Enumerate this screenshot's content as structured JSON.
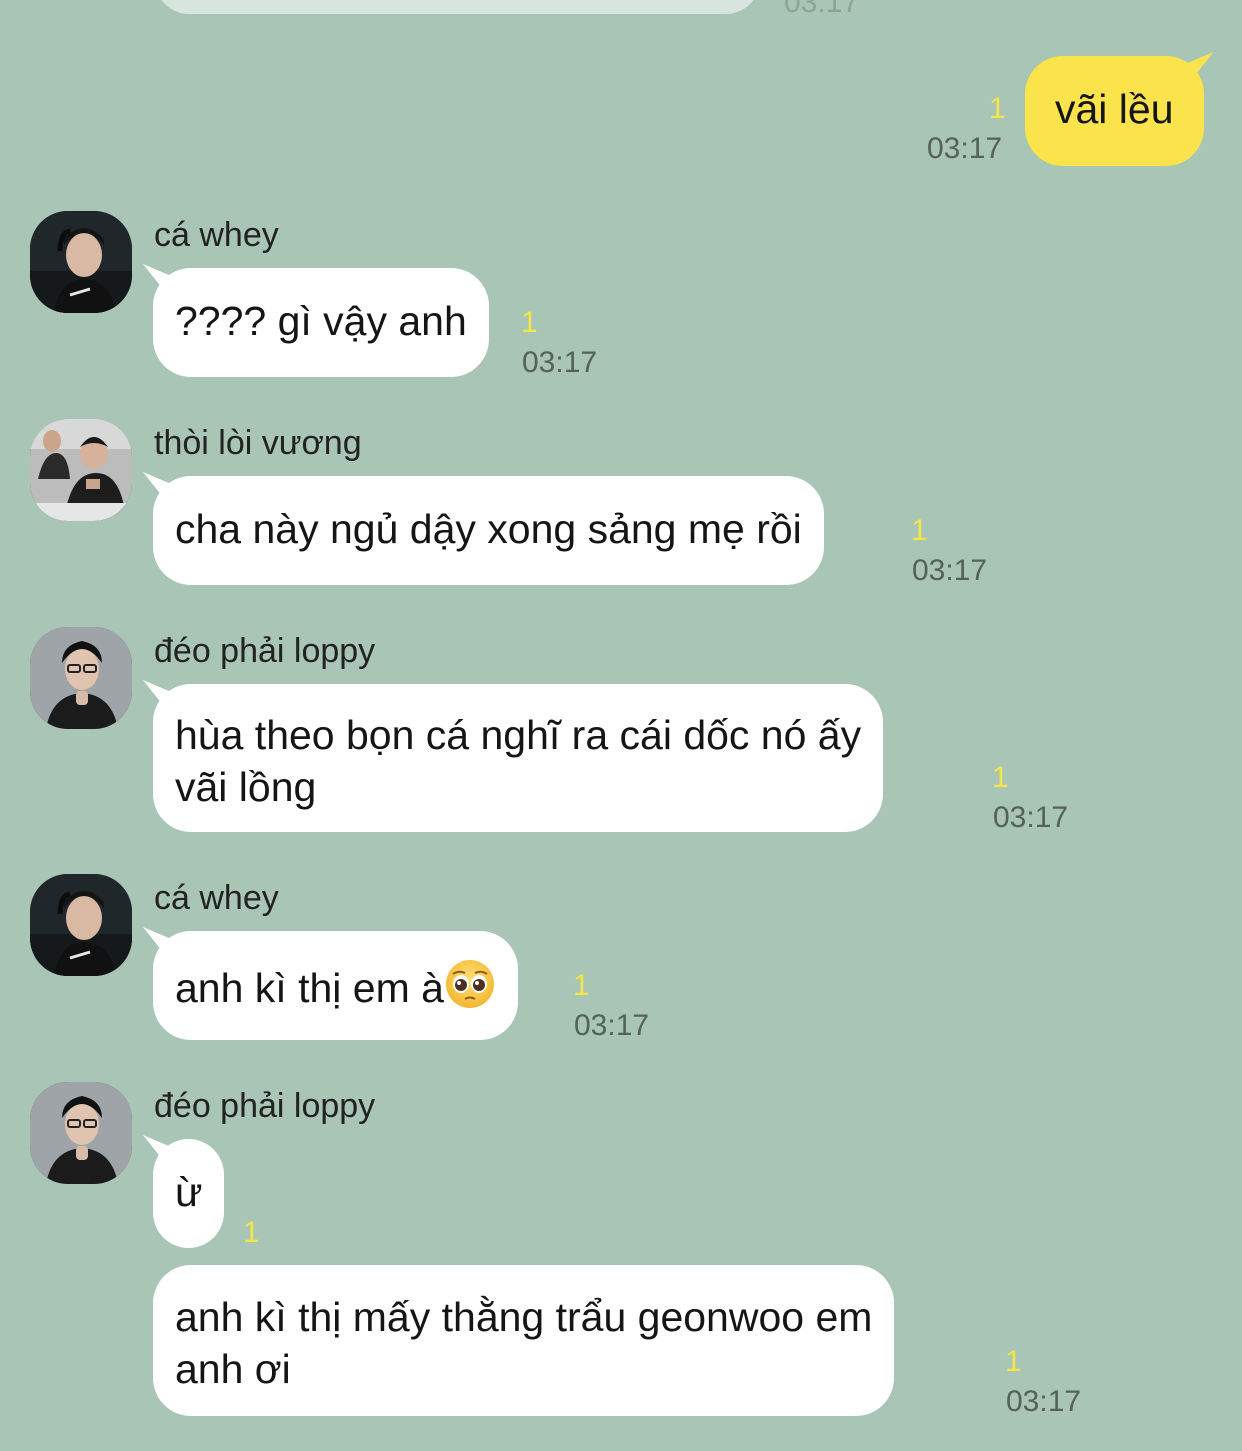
{
  "previous": {
    "time": "03:17"
  },
  "messages": [
    {
      "sender": "",
      "text": "vãi lều",
      "unread": "1",
      "time": "03:17",
      "mine": true
    },
    {
      "sender": "cá whey",
      "text": "???? gì vậy anh",
      "unread": "1",
      "time": "03:17"
    },
    {
      "sender": "thòi lòi vương",
      "text": "cha này ngủ dậy xong sảng mẹ rồi",
      "unread": "1",
      "time": "03:17"
    },
    {
      "sender": "đéo phải loppy",
      "line1": "hùa theo bọn cá nghĩ ra cái dốc nó ấy",
      "line2": "vãi lồng",
      "unread": "1",
      "time": "03:17"
    },
    {
      "sender": "cá whey",
      "text": "anh kì thị em à",
      "emoji": "pleading-face-emoji",
      "unread": "1",
      "time": "03:17"
    },
    {
      "sender": "đéo phải loppy",
      "text": "ừ",
      "unread": "1"
    },
    {
      "sender": "",
      "line1": "anh kì thị mấy thằng trẩu geonwoo em",
      "line2": "anh ơi",
      "unread": "1",
      "time": "03:17"
    }
  ],
  "avatars": {
    "ca_whey": "avatar-ca-whey",
    "thoi_loi_vuong": "avatar-thoi-loi-vuong",
    "deo_phai_loppy": "avatar-deo-phai-loppy"
  },
  "colors": {
    "background": "#a8c5b5",
    "my_bubble": "#fbe44b",
    "their_bubble": "#ffffff",
    "unread": "#f5e64a"
  }
}
